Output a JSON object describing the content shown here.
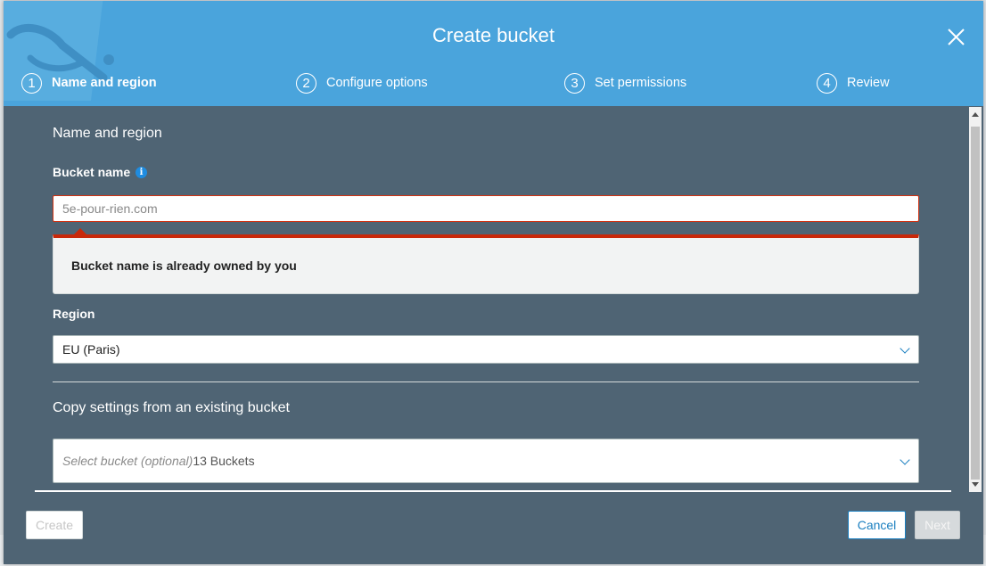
{
  "dialog": {
    "title": "Create bucket",
    "close_icon": "close-icon"
  },
  "steps": [
    {
      "number": "1",
      "label": "Name and region",
      "active": true
    },
    {
      "number": "2",
      "label": "Configure options",
      "active": false
    },
    {
      "number": "3",
      "label": "Set permissions",
      "active": false
    },
    {
      "number": "4",
      "label": "Review",
      "active": false
    }
  ],
  "name_region": {
    "section_title": "Name and region",
    "bucket_name_label": "Bucket name",
    "info_icon": "info-icon",
    "info_glyph": "i",
    "bucket_name_value": "5e-pour-rien.com",
    "error_message": "Bucket name is already owned by you",
    "region_label": "Region",
    "region_value": "EU (Paris)"
  },
  "copy_settings": {
    "section_title": "Copy settings from an existing bucket",
    "placeholder": "Select bucket (optional)",
    "count": "13 Buckets"
  },
  "footer": {
    "create_label": "Create",
    "cancel_label": "Cancel",
    "next_label": "Next"
  },
  "colors": {
    "header": "#4aa4dc",
    "body": "#4f6474",
    "error": "#d13212",
    "link": "#1a7fc0"
  }
}
